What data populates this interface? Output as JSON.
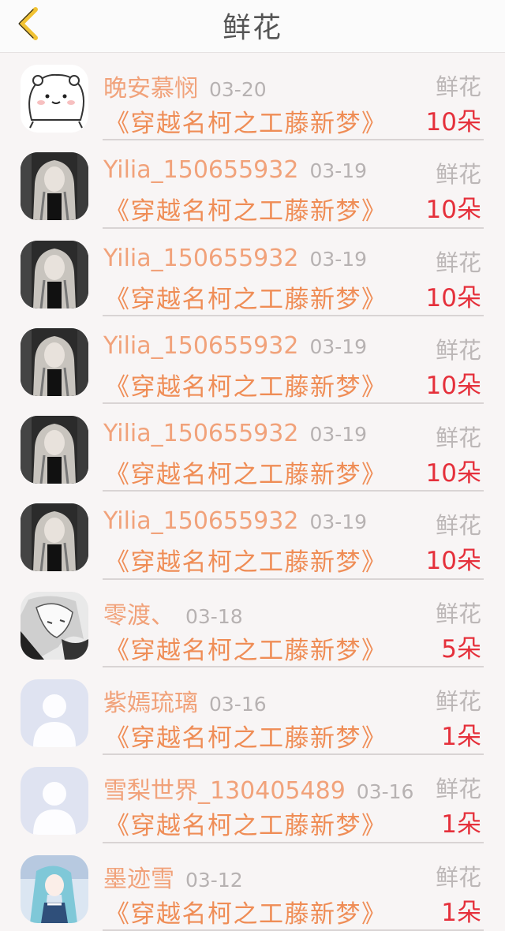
{
  "header": {
    "title": "鲜花",
    "back_icon": "chevron-left-icon",
    "accent": "#f1c232"
  },
  "colors": {
    "name": "#f1a27a",
    "book": "#ef8d56",
    "count": "#e5303b",
    "muted": "#bcb7b7"
  },
  "records": [
    {
      "name": "晚安慕悯",
      "date": "03-20",
      "book": "《穿越名柯之工藤新梦》",
      "gift": "鲜花",
      "count": "10朵",
      "avatar": "cartoon"
    },
    {
      "name": "Yilia_150655932",
      "date": "03-19",
      "book": "《穿越名柯之工藤新梦》",
      "gift": "鲜花",
      "count": "10朵",
      "avatar": "dark"
    },
    {
      "name": "Yilia_150655932",
      "date": "03-19",
      "book": "《穿越名柯之工藤新梦》",
      "gift": "鲜花",
      "count": "10朵",
      "avatar": "dark"
    },
    {
      "name": "Yilia_150655932",
      "date": "03-19",
      "book": "《穿越名柯之工藤新梦》",
      "gift": "鲜花",
      "count": "10朵",
      "avatar": "dark"
    },
    {
      "name": "Yilia_150655932",
      "date": "03-19",
      "book": "《穿越名柯之工藤新梦》",
      "gift": "鲜花",
      "count": "10朵",
      "avatar": "dark"
    },
    {
      "name": "Yilia_150655932",
      "date": "03-19",
      "book": "《穿越名柯之工藤新梦》",
      "gift": "鲜花",
      "count": "10朵",
      "avatar": "dark"
    },
    {
      "name": "零渡、",
      "date": "03-18",
      "book": "《穿越名柯之工藤新梦》",
      "gift": "鲜花",
      "count": "5朵",
      "avatar": "sketch"
    },
    {
      "name": "紫嫣琉璃",
      "date": "03-16",
      "book": "《穿越名柯之工藤新梦》",
      "gift": "鲜花",
      "count": "1朵",
      "avatar": "default"
    },
    {
      "name": "雪梨世界_130405489",
      "date": "03-16",
      "book": "《穿越名柯之工藤新梦》",
      "gift": "鲜花",
      "count": "1朵",
      "avatar": "default"
    },
    {
      "name": "墨迹雪",
      "date": "03-12",
      "book": "《穿越名柯之工藤新梦》",
      "gift": "鲜花",
      "count": "1朵",
      "avatar": "anime"
    }
  ]
}
